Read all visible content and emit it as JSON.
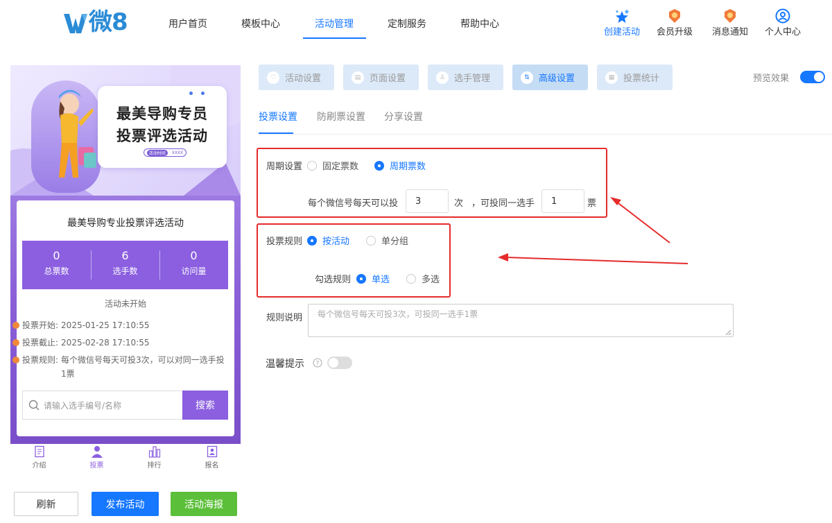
{
  "header": {
    "logo_text": "微8",
    "nav": [
      "用户首页",
      "模板中心",
      "活动管理",
      "定制服务",
      "帮助中心"
    ],
    "active_nav": "活动管理",
    "actions": [
      {
        "label": "创建活动",
        "icon": "stars-icon"
      },
      {
        "label": "会员升级",
        "icon": "medal-icon"
      },
      {
        "label": "消息通知",
        "icon": "bell-medal-icon"
      },
      {
        "label": "个人中心",
        "icon": "user-circle-icon"
      }
    ]
  },
  "preview": {
    "banner": {
      "title_line1": "最美导购专员",
      "title_line2": "投票评选活动",
      "pill_left": "活动时间",
      "pill_right": "XXXX"
    },
    "card": {
      "title": "最美导购专业投票评选活动",
      "stats": [
        {
          "value": "0",
          "label": "总票数"
        },
        {
          "value": "6",
          "label": "选手数"
        },
        {
          "value": "0",
          "label": "访问量"
        }
      ],
      "status": "活动未开始",
      "rules": [
        {
          "label": "投票开始:",
          "text": "2025-01-25 17:10:55"
        },
        {
          "label": "投票截止:",
          "text": "2025-02-28 17:10:55"
        },
        {
          "label": "投票规则:",
          "text": "每个微信号每天可投3次，可以对同一选手投1票"
        }
      ],
      "search_placeholder": "请输入选手编号/名称",
      "search_button": "搜索"
    },
    "tabbar": [
      {
        "label": "介绍",
        "icon": "document-icon"
      },
      {
        "label": "投票",
        "icon": "person-icon"
      },
      {
        "label": "排行",
        "icon": "ranking-icon"
      },
      {
        "label": "报名",
        "icon": "signup-icon"
      }
    ],
    "buttons": {
      "refresh": "刷新",
      "publish": "发布活动",
      "poster": "活动海报"
    }
  },
  "steps": [
    {
      "label": "活动设置",
      "icon": "heart-icon"
    },
    {
      "label": "页面设置",
      "icon": "page-icon"
    },
    {
      "label": "选手管理",
      "icon": "user-icon"
    },
    {
      "label": "高级设置",
      "icon": "sliders-icon"
    },
    {
      "label": "投票统计",
      "icon": "stats-icon"
    }
  ],
  "active_step": "高级设置",
  "preview_toggle": {
    "label": "预览效果",
    "on": true
  },
  "subtabs": [
    "投票设置",
    "防刷票设置",
    "分享设置"
  ],
  "active_subtab": "投票设置",
  "form": {
    "period": {
      "label": "周期设置",
      "options": [
        "固定票数",
        "周期票数"
      ],
      "selected": "周期票数"
    },
    "per_day": {
      "prefix": "每个微信号每天可以投",
      "times": "3",
      "times_unit": "次",
      "middle": "，可投同一选手",
      "votes": "1",
      "votes_unit": "票"
    },
    "vote_rule": {
      "label": "投票规则",
      "options": [
        "按活动",
        "单分组"
      ],
      "selected": "按活动"
    },
    "check_rule": {
      "label": "勾选规则",
      "options": [
        "单选",
        "多选"
      ],
      "selected": "单选"
    },
    "rule_desc": {
      "label": "规则说明",
      "placeholder": "每个微信号每天可投3次，可投同一选手1票"
    },
    "tip": {
      "label": "温馨提示",
      "on": false
    }
  },
  "colors": {
    "accent": "#1677ff",
    "purple": "#8b5fe0",
    "red_annotation": "#e52b2b",
    "green": "#5cbf3a"
  }
}
